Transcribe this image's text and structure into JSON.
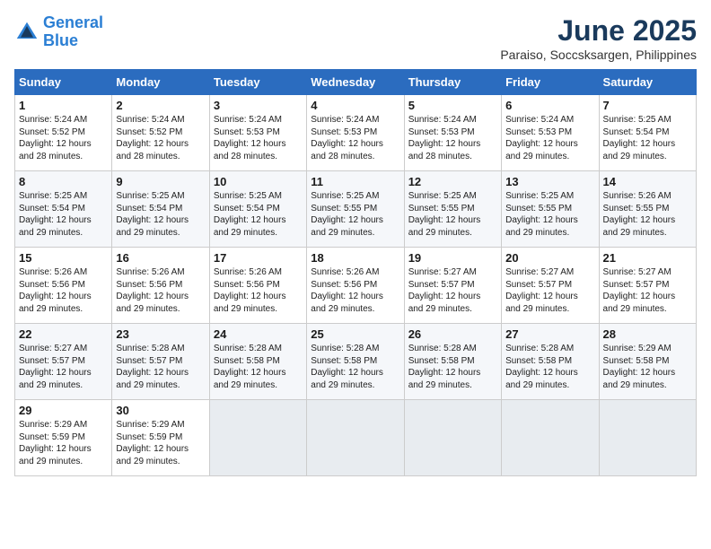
{
  "logo": {
    "line1": "General",
    "line2": "Blue"
  },
  "title": "June 2025",
  "location": "Paraiso, Soccsksargen, Philippines",
  "days_of_week": [
    "Sunday",
    "Monday",
    "Tuesday",
    "Wednesday",
    "Thursday",
    "Friday",
    "Saturday"
  ],
  "weeks": [
    [
      {
        "day": "1",
        "sunrise": "5:24 AM",
        "sunset": "5:52 PM",
        "daylight": "12 hours and 28 minutes."
      },
      {
        "day": "2",
        "sunrise": "5:24 AM",
        "sunset": "5:52 PM",
        "daylight": "12 hours and 28 minutes."
      },
      {
        "day": "3",
        "sunrise": "5:24 AM",
        "sunset": "5:53 PM",
        "daylight": "12 hours and 28 minutes."
      },
      {
        "day": "4",
        "sunrise": "5:24 AM",
        "sunset": "5:53 PM",
        "daylight": "12 hours and 28 minutes."
      },
      {
        "day": "5",
        "sunrise": "5:24 AM",
        "sunset": "5:53 PM",
        "daylight": "12 hours and 28 minutes."
      },
      {
        "day": "6",
        "sunrise": "5:24 AM",
        "sunset": "5:53 PM",
        "daylight": "12 hours and 29 minutes."
      },
      {
        "day": "7",
        "sunrise": "5:25 AM",
        "sunset": "5:54 PM",
        "daylight": "12 hours and 29 minutes."
      }
    ],
    [
      {
        "day": "8",
        "sunrise": "5:25 AM",
        "sunset": "5:54 PM",
        "daylight": "12 hours and 29 minutes."
      },
      {
        "day": "9",
        "sunrise": "5:25 AM",
        "sunset": "5:54 PM",
        "daylight": "12 hours and 29 minutes."
      },
      {
        "day": "10",
        "sunrise": "5:25 AM",
        "sunset": "5:54 PM",
        "daylight": "12 hours and 29 minutes."
      },
      {
        "day": "11",
        "sunrise": "5:25 AM",
        "sunset": "5:55 PM",
        "daylight": "12 hours and 29 minutes."
      },
      {
        "day": "12",
        "sunrise": "5:25 AM",
        "sunset": "5:55 PM",
        "daylight": "12 hours and 29 minutes."
      },
      {
        "day": "13",
        "sunrise": "5:25 AM",
        "sunset": "5:55 PM",
        "daylight": "12 hours and 29 minutes."
      },
      {
        "day": "14",
        "sunrise": "5:26 AM",
        "sunset": "5:55 PM",
        "daylight": "12 hours and 29 minutes."
      }
    ],
    [
      {
        "day": "15",
        "sunrise": "5:26 AM",
        "sunset": "5:56 PM",
        "daylight": "12 hours and 29 minutes."
      },
      {
        "day": "16",
        "sunrise": "5:26 AM",
        "sunset": "5:56 PM",
        "daylight": "12 hours and 29 minutes."
      },
      {
        "day": "17",
        "sunrise": "5:26 AM",
        "sunset": "5:56 PM",
        "daylight": "12 hours and 29 minutes."
      },
      {
        "day": "18",
        "sunrise": "5:26 AM",
        "sunset": "5:56 PM",
        "daylight": "12 hours and 29 minutes."
      },
      {
        "day": "19",
        "sunrise": "5:27 AM",
        "sunset": "5:57 PM",
        "daylight": "12 hours and 29 minutes."
      },
      {
        "day": "20",
        "sunrise": "5:27 AM",
        "sunset": "5:57 PM",
        "daylight": "12 hours and 29 minutes."
      },
      {
        "day": "21",
        "sunrise": "5:27 AM",
        "sunset": "5:57 PM",
        "daylight": "12 hours and 29 minutes."
      }
    ],
    [
      {
        "day": "22",
        "sunrise": "5:27 AM",
        "sunset": "5:57 PM",
        "daylight": "12 hours and 29 minutes."
      },
      {
        "day": "23",
        "sunrise": "5:28 AM",
        "sunset": "5:57 PM",
        "daylight": "12 hours and 29 minutes."
      },
      {
        "day": "24",
        "sunrise": "5:28 AM",
        "sunset": "5:58 PM",
        "daylight": "12 hours and 29 minutes."
      },
      {
        "day": "25",
        "sunrise": "5:28 AM",
        "sunset": "5:58 PM",
        "daylight": "12 hours and 29 minutes."
      },
      {
        "day": "26",
        "sunrise": "5:28 AM",
        "sunset": "5:58 PM",
        "daylight": "12 hours and 29 minutes."
      },
      {
        "day": "27",
        "sunrise": "5:28 AM",
        "sunset": "5:58 PM",
        "daylight": "12 hours and 29 minutes."
      },
      {
        "day": "28",
        "sunrise": "5:29 AM",
        "sunset": "5:58 PM",
        "daylight": "12 hours and 29 minutes."
      }
    ],
    [
      {
        "day": "29",
        "sunrise": "5:29 AM",
        "sunset": "5:59 PM",
        "daylight": "12 hours and 29 minutes."
      },
      {
        "day": "30",
        "sunrise": "5:29 AM",
        "sunset": "5:59 PM",
        "daylight": "12 hours and 29 minutes."
      },
      null,
      null,
      null,
      null,
      null
    ]
  ]
}
